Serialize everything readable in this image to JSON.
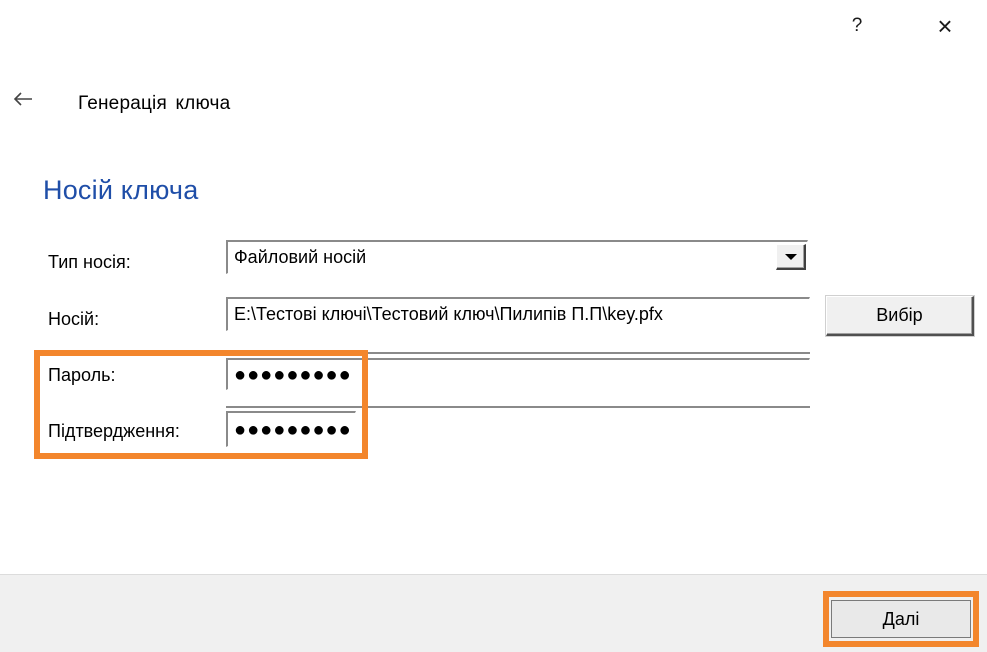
{
  "titlebar": {
    "help_label": "?",
    "close_label": "×"
  },
  "nav": {
    "back_icon": "back-arrow-icon",
    "title": "Генерація ключа"
  },
  "section": {
    "title": "Носій ключа"
  },
  "form": {
    "media_type": {
      "label": "Тип носія:",
      "value": "Файловий носій"
    },
    "media": {
      "label": "Носій:",
      "value": "E:\\Тестові ключі\\Тестовий ключ\\Пилипів П.П\\key.pfx",
      "select_button_label": "Вибір"
    },
    "password": {
      "label": "Пароль:",
      "value_masked": "●●●●●●●●●"
    },
    "confirmation": {
      "label": "Підтвердження:",
      "value_masked": "●●●●●●●●●"
    }
  },
  "footer": {
    "next_label": "Далі"
  },
  "colors": {
    "section_title": "#1f4ea8",
    "highlight": "#f3862c",
    "footer_bg": "#f0f0f0"
  }
}
